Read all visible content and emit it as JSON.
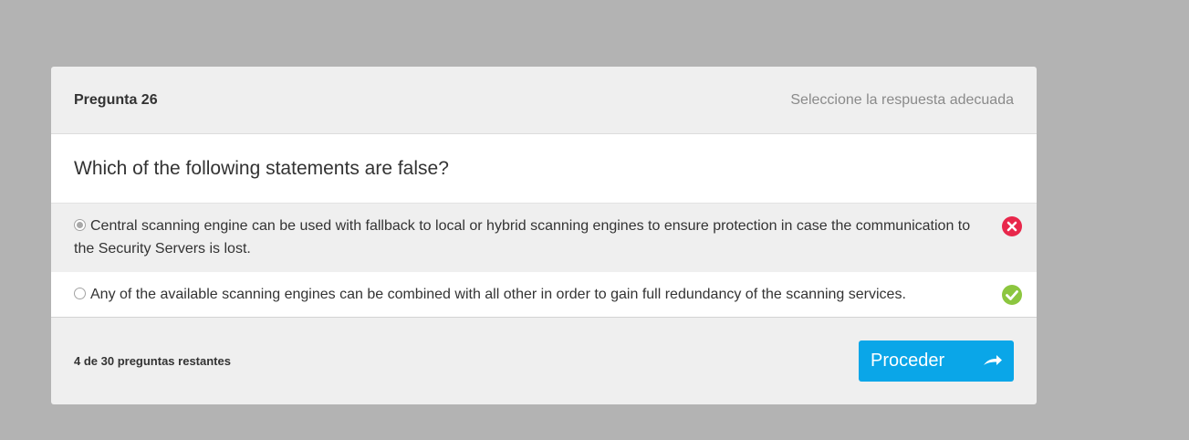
{
  "header": {
    "question_number": "Pregunta 26",
    "instruction": "Seleccione la respuesta adecuada"
  },
  "question": {
    "text": "Which of the following statements are false?"
  },
  "answers": [
    {
      "text": "Central scanning engine can be used with fallback to local or hybrid scanning engines to ensure protection in case the communication to the Security Servers is lost.",
      "selected": true,
      "status_icon": "x-circle-icon",
      "status_color": "#e8274b"
    },
    {
      "text": "Any of the available scanning engines can be combined with all other in order to gain full redundancy of the scanning services.",
      "selected": false,
      "status_icon": "check-circle-icon",
      "status_color": "#8cc63f"
    }
  ],
  "footer": {
    "remaining": "4 de 30 preguntas restantes",
    "proceed_label": "Proceder",
    "proceed_color": "#0aa6e8"
  }
}
